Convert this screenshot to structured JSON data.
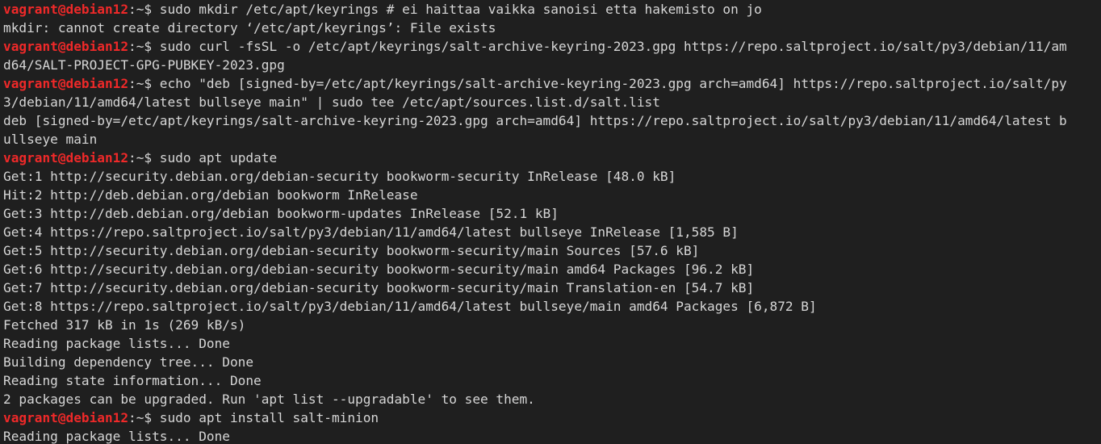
{
  "terminal": {
    "colors": {
      "background": "#1f1f1f",
      "text": "#d6d6d6",
      "prompt": "#ef2929"
    },
    "lines": [
      {
        "type": "prompt",
        "user": "vagrant@debian12",
        "path_sep": ":~$ ",
        "cmd": "sudo mkdir /etc/apt/keyrings # ei haittaa vaikka sanoisi etta hakemisto on jo"
      },
      {
        "type": "out",
        "text": "mkdir: cannot create directory ‘/etc/apt/keyrings’: File exists"
      },
      {
        "type": "prompt",
        "user": "vagrant@debian12",
        "path_sep": ":~$ ",
        "cmd": "sudo curl -fsSL -o /etc/apt/keyrings/salt-archive-keyring-2023.gpg https://repo.saltproject.io/salt/py3/debian/11/am"
      },
      {
        "type": "out",
        "text": "d64/SALT-PROJECT-GPG-PUBKEY-2023.gpg"
      },
      {
        "type": "prompt",
        "user": "vagrant@debian12",
        "path_sep": ":~$ ",
        "cmd": "echo \"deb [signed-by=/etc/apt/keyrings/salt-archive-keyring-2023.gpg arch=amd64] https://repo.saltproject.io/salt/py"
      },
      {
        "type": "out",
        "text": "3/debian/11/amd64/latest bullseye main\" | sudo tee /etc/apt/sources.list.d/salt.list"
      },
      {
        "type": "out",
        "text": "deb [signed-by=/etc/apt/keyrings/salt-archive-keyring-2023.gpg arch=amd64] https://repo.saltproject.io/salt/py3/debian/11/amd64/latest b"
      },
      {
        "type": "out",
        "text": "ullseye main"
      },
      {
        "type": "prompt",
        "user": "vagrant@debian12",
        "path_sep": ":~$ ",
        "cmd": "sudo apt update"
      },
      {
        "type": "out",
        "text": "Get:1 http://security.debian.org/debian-security bookworm-security InRelease [48.0 kB]"
      },
      {
        "type": "out",
        "text": "Hit:2 http://deb.debian.org/debian bookworm InRelease"
      },
      {
        "type": "out",
        "text": "Get:3 http://deb.debian.org/debian bookworm-updates InRelease [52.1 kB]"
      },
      {
        "type": "out",
        "text": "Get:4 https://repo.saltproject.io/salt/py3/debian/11/amd64/latest bullseye InRelease [1,585 B]"
      },
      {
        "type": "out",
        "text": "Get:5 http://security.debian.org/debian-security bookworm-security/main Sources [57.6 kB]"
      },
      {
        "type": "out",
        "text": "Get:6 http://security.debian.org/debian-security bookworm-security/main amd64 Packages [96.2 kB]"
      },
      {
        "type": "out",
        "text": "Get:7 http://security.debian.org/debian-security bookworm-security/main Translation-en [54.7 kB]"
      },
      {
        "type": "out",
        "text": "Get:8 https://repo.saltproject.io/salt/py3/debian/11/amd64/latest bullseye/main amd64 Packages [6,872 B]"
      },
      {
        "type": "out",
        "text": "Fetched 317 kB in 1s (269 kB/s)"
      },
      {
        "type": "out",
        "text": "Reading package lists... Done"
      },
      {
        "type": "out",
        "text": "Building dependency tree... Done"
      },
      {
        "type": "out",
        "text": "Reading state information... Done"
      },
      {
        "type": "out",
        "text": "2 packages can be upgraded. Run 'apt list --upgradable' to see them."
      },
      {
        "type": "prompt",
        "user": "vagrant@debian12",
        "path_sep": ":~$ ",
        "cmd": "sudo apt install salt-minion"
      },
      {
        "type": "out",
        "text": "Reading package lists... Done"
      }
    ]
  }
}
